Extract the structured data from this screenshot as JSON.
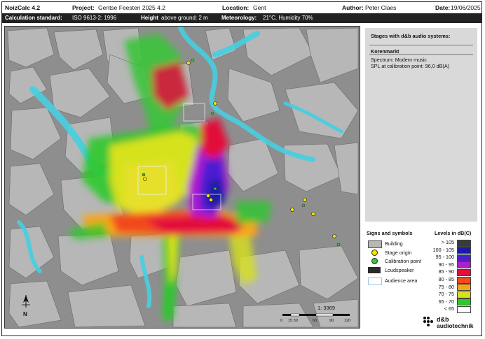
{
  "header": {
    "app_title": "NoizCalc 4.2",
    "project_label": "Project:",
    "project_value": "Gentse Feesten 2025 4.2",
    "location_label": "Location:",
    "location_value": "Gent",
    "author_label": "Author:",
    "author_value": "Peter Claes",
    "date_label": "Date:",
    "date_value": "19/06/2025"
  },
  "subheader": {
    "calc_label": "Calculation standard:",
    "calc_value": "ISO 9613-2: 1996",
    "height_label": "Height",
    "height_value": "above ground: 2 m",
    "meteo_label": "Meteorology:",
    "meteo_value": "21°C, Humidity 70%"
  },
  "stages_panel": {
    "title": "Stages with d&b audio systems:",
    "stage_name": "Korenmarkt",
    "spectrum": "Spectrum:  Modern music",
    "spl": "SPL at calibration point:  96,0 dB(A)"
  },
  "signs": {
    "title": "Signs and symbols",
    "items": [
      {
        "label": "Building",
        "icon": "building-icon"
      },
      {
        "label": "Stage origin",
        "icon": "stage-origin-icon",
        "color": "#f5e600"
      },
      {
        "label": "Calibration point",
        "icon": "calibration-point-icon",
        "color": "#3cc43c"
      },
      {
        "label": "Loudspeaker",
        "icon": "loudspeaker-icon"
      },
      {
        "label": "Audience area",
        "icon": "audience-area-icon"
      }
    ]
  },
  "levels": {
    "title": "Levels in dB(C)",
    "items": [
      {
        "label": "> 105",
        "color": "#3a3a3a"
      },
      {
        "label": "100 - 105",
        "color": "#1a1aa8"
      },
      {
        "label": "95 - 100",
        "color": "#4b1fd0"
      },
      {
        "label": "90 - 95",
        "color": "#b01ecf"
      },
      {
        "label": "85 - 90",
        "color": "#e3103b"
      },
      {
        "label": "80 - 85",
        "color": "#f24a1e"
      },
      {
        "label": "75 - 80",
        "color": "#f7a41c"
      },
      {
        "label": "70 - 75",
        "color": "#d6e21b"
      },
      {
        "label": "65 - 70",
        "color": "#2cc92c"
      },
      {
        "label": "< 65",
        "color": "#ffffff"
      }
    ]
  },
  "map": {
    "scale_text": "1: 3369",
    "scale_ticks": [
      "0",
      "15 30",
      "60",
      "90",
      "120"
    ],
    "north_label": "N"
  },
  "logo": {
    "line1": "d&b",
    "line2": "audiotechnik"
  }
}
